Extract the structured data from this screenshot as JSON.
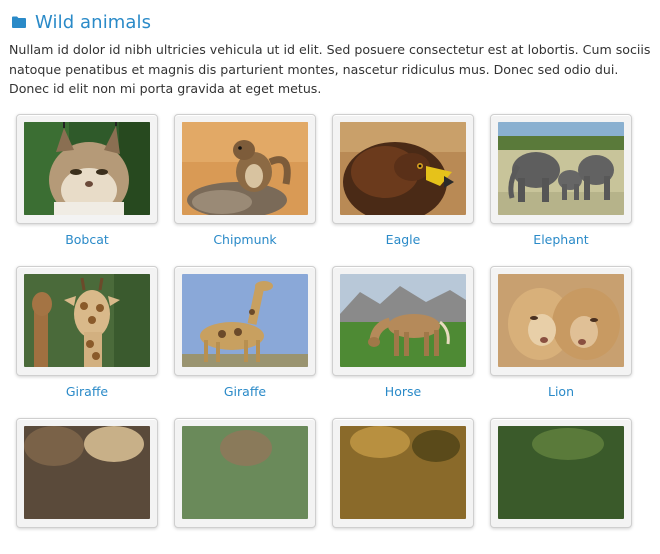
{
  "page": {
    "title": "Wild animals",
    "icon": "folder-icon",
    "accent_color": "#2a8ac8",
    "description": "Nullam id dolor id nibh ultricies vehicula ut id elit. Sed posuere consectetur est at lobortis. Cum sociis natoque penatibus et magnis dis parturient montes, nascetur ridiculus mus. Donec sed odio dui. Donec id elit non mi porta gravida at eget metus."
  },
  "gallery": {
    "items": [
      {
        "label": "Bobcat"
      },
      {
        "label": "Chipmunk"
      },
      {
        "label": "Eagle"
      },
      {
        "label": "Elephant"
      },
      {
        "label": "Giraffe"
      },
      {
        "label": "Giraffe"
      },
      {
        "label": "Horse"
      },
      {
        "label": "Lion"
      },
      {
        "label": ""
      },
      {
        "label": ""
      },
      {
        "label": ""
      },
      {
        "label": ""
      }
    ]
  }
}
